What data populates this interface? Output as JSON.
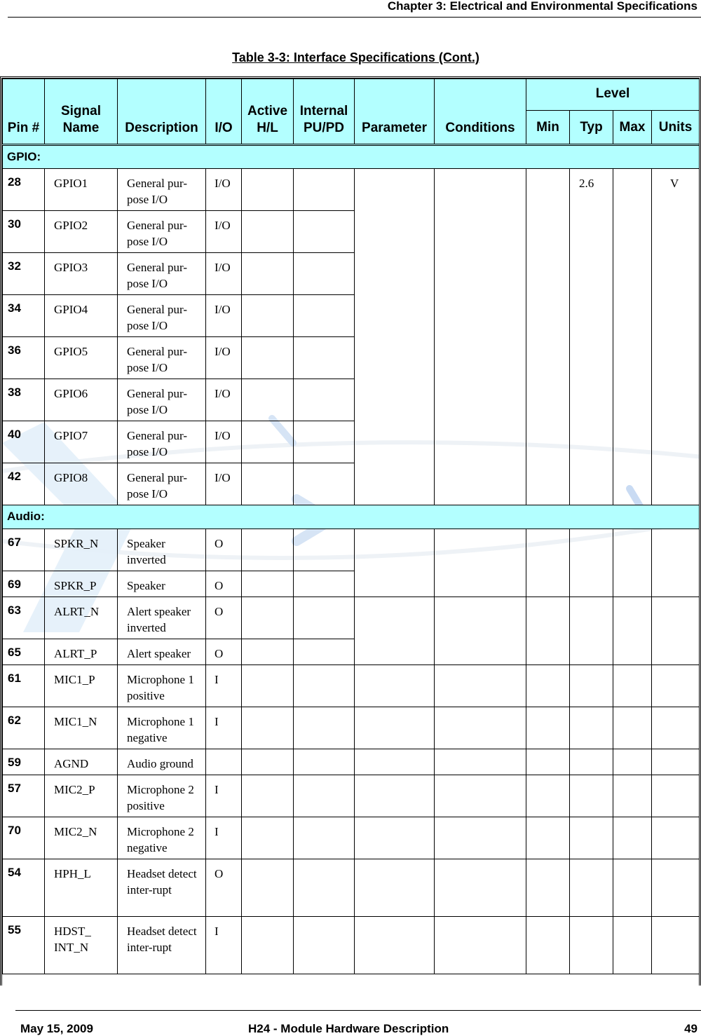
{
  "page": {
    "chapter_header": "Chapter 3:  Electrical and Environmental Specifications",
    "table_title": "Table 3-3: Interface Specifications (Cont.)",
    "footer": {
      "date": "May 15, 2009",
      "document_title": "H24 - Module Hardware Description",
      "page_number": "49"
    }
  },
  "table": {
    "headers": {
      "pin": "Pin #",
      "signal_name": "Signal Name",
      "description": "Description",
      "io": "I/O",
      "active": "Active H/L",
      "internal": "Internal PU/PD",
      "parameter": "Parameter",
      "conditions": "Conditions",
      "level": "Level",
      "min": "Min",
      "typ": "Typ",
      "max": "Max",
      "units": "Units"
    },
    "sections": [
      {
        "label": "GPIO:",
        "shared": {
          "parameter": "",
          "conditions": "",
          "min": "",
          "typ": "2.6",
          "max": "",
          "units": "V"
        },
        "rows": [
          {
            "pin": "28",
            "signal": "GPIO1",
            "description": "General pur-pose I/O",
            "io": "I/O"
          },
          {
            "pin": "30",
            "signal": "GPIO2",
            "description": "General pur-pose I/O",
            "io": "I/O"
          },
          {
            "pin": "32",
            "signal": "GPIO3",
            "description": "General pur-pose I/O",
            "io": "I/O"
          },
          {
            "pin": "34",
            "signal": "GPIO4",
            "description": "General pur-pose I/O",
            "io": "I/O"
          },
          {
            "pin": "36",
            "signal": "GPIO5",
            "description": "General pur-pose I/O",
            "io": "I/O"
          },
          {
            "pin": "38",
            "signal": "GPIO6",
            "description": "General pur-pose I/O",
            "io": "I/O"
          },
          {
            "pin": "40",
            "signal": "GPIO7",
            "description": "General pur-pose I/O",
            "io": "I/O"
          },
          {
            "pin": "42",
            "signal": "GPIO8",
            "description": "General pur-pose I/O",
            "io": "I/O"
          }
        ]
      },
      {
        "label": "Audio:",
        "rows": [
          {
            "pin": "67",
            "signal": "SPKR_N",
            "description": "Speaker inverted",
            "io": "O"
          },
          {
            "pin": "69",
            "signal": "SPKR_P",
            "description": "Speaker",
            "io": "O"
          },
          {
            "pin": "63",
            "signal": "ALRT_N",
            "description": "Alert speaker inverted",
            "io": "O"
          },
          {
            "pin": "65",
            "signal": "ALRT_P",
            "description": "Alert speaker",
            "io": "O"
          },
          {
            "pin": "61",
            "signal": "MIC1_P",
            "description": "Microphone 1 positive",
            "io": "I"
          },
          {
            "pin": "62",
            "signal": "MIC1_N",
            "description": "Microphone 1 negative",
            "io": "I"
          },
          {
            "pin": "59",
            "signal": "AGND",
            "description": "Audio ground",
            "io": ""
          },
          {
            "pin": "57",
            "signal": "MIC2_P",
            "description": "Microphone 2 positive",
            "io": "I"
          },
          {
            "pin": "70",
            "signal": "MIC2_N",
            "description": "Microphone 2 negative",
            "io": "I"
          },
          {
            "pin": "54",
            "signal": "HPH_L",
            "description": "Headset detect inter-rupt",
            "io": "O"
          },
          {
            "pin": "55",
            "signal": "HDST_ INT_N",
            "description": "Headset detect inter-rupt",
            "io": "I"
          }
        ]
      }
    ]
  },
  "colors": {
    "header_fill": "#b3ffff",
    "watermark": "#cfe3f5"
  }
}
